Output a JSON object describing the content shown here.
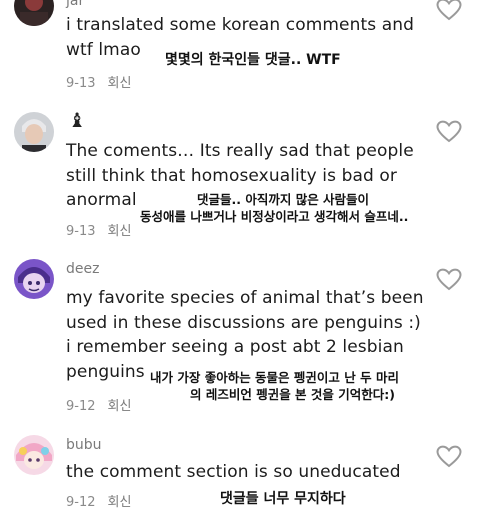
{
  "comments": [
    {
      "username": "jar",
      "text": "i translated some korean comments and wtf lmao",
      "date": "9-13",
      "reply_label": "회신",
      "overlay": "몇몇의 한국인들 댓글.. WTF"
    },
    {
      "username": "♝",
      "text": "The coments… Its really sad that people still think that homosexuality is bad or anormal",
      "date": "9-13",
      "reply_label": "회신",
      "overlay_line1": "댓글들.. 아직까지 많은 사람들이",
      "overlay_line2": "동성애를 나쁘거나 비정상이라고 생각해서 슬프네.."
    },
    {
      "username": "deez",
      "text": "my favorite species of animal that’s been used in these discussions are penguins :) i remember seeing a post abt 2 lesbian penguins",
      "date": "9-12",
      "reply_label": "회신",
      "overlay_line1": "내가 가장 좋아하는 동물은 펭귄이고 난 두 마리",
      "overlay_line2": "의 레즈비언 펭귄을 본 것을 기억한다:)"
    },
    {
      "username": "bubu",
      "text": "the comment section is so uneducated",
      "date": "9-12",
      "reply_label": "회신",
      "overlay": "댓글들 너무 무지하다"
    }
  ],
  "icons": {
    "like": "heart-outline-icon"
  },
  "colors": {
    "text": "#1c1c1c",
    "meta": "#8a8a8a",
    "username": "#7a7a7a",
    "icon": "#9a9a9a"
  }
}
